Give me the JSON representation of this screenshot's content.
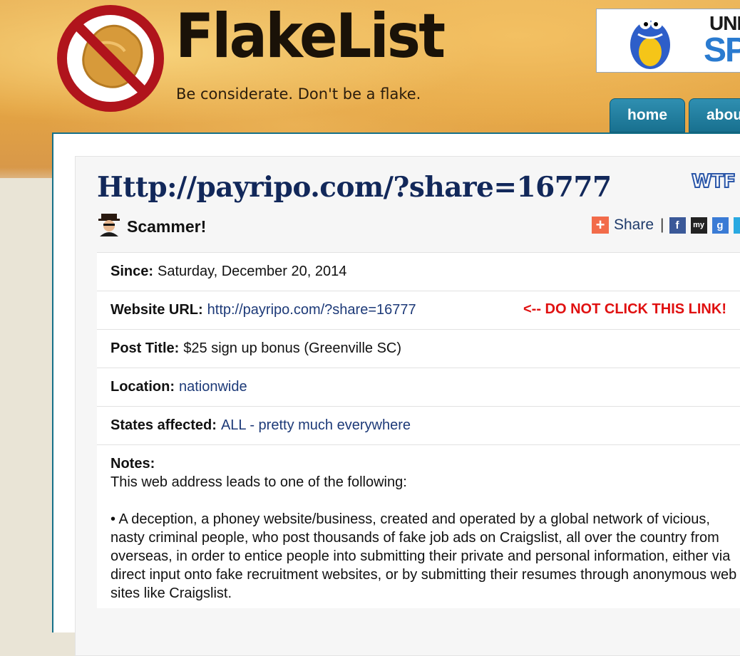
{
  "site": {
    "name": "FlakeList",
    "tagline": "Be considerate. Don't be a flake."
  },
  "ad": {
    "line1": "UNLI",
    "line2": "SP"
  },
  "nav": [
    {
      "label": "home"
    },
    {
      "label": "abou"
    }
  ],
  "post": {
    "title": "Http://payripo.com/?share=16777",
    "badge": "WTF",
    "status": "Scammer!",
    "share_label": "Share",
    "share_sep": "|",
    "fields": {
      "since_label": "Since:",
      "since_value": "Saturday, December 20, 2014",
      "url_label": "Website URL:",
      "url_value": "http://payripo.com/?share=16777",
      "url_warning": "<-- DO NOT CLICK THIS LINK!",
      "post_title_label": "Post Title:",
      "post_title_value": "$25 sign up bonus (Greenville SC)",
      "location_label": "Location:",
      "location_value": "nationwide",
      "states_label": "States affected:",
      "states_value": "ALL - pretty much everywhere"
    },
    "notes": {
      "label": "Notes:",
      "intro": "This web address leads to one of the following:",
      "bullet1": "• A deception, a phoney website/business, created and operated by a global network of vicious, nasty criminal people, who post thousands of fake job ads on Craigslist, all over the country from overseas, in order to entice people into submitting their private and personal information, either via direct input onto fake recruitment websites, or by submitting their resumes through anonymous web sites like Craigslist."
    }
  },
  "social": [
    {
      "icon": "facebook-icon",
      "glyph": "f",
      "color": "#3b5998"
    },
    {
      "icon": "myspace-icon",
      "glyph": "my",
      "color": "#222222"
    },
    {
      "icon": "google-icon",
      "glyph": "g",
      "color": "#3a7bd5"
    },
    {
      "icon": "twitter-icon",
      "glyph": "",
      "color": "#29a9e1"
    }
  ],
  "colors": {
    "title": "#12285a",
    "link": "#1d3a78",
    "warning": "#e01010",
    "nav": "#1c7a9b"
  }
}
